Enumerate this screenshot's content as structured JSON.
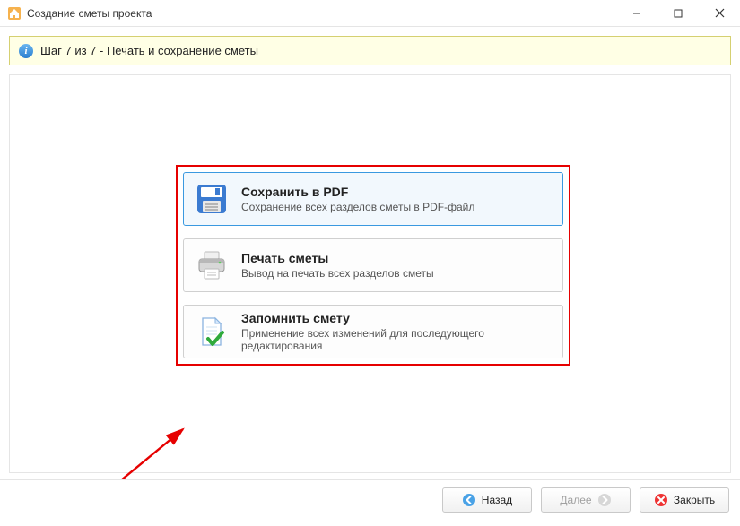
{
  "window": {
    "title": "Создание сметы проекта"
  },
  "infobar": {
    "text": "Шаг 7 из 7 - Печать и сохранение сметы"
  },
  "options": {
    "save_pdf": {
      "title": "Сохранить в PDF",
      "desc": "Сохранение всех разделов сметы в PDF-файл"
    },
    "print": {
      "title": "Печать сметы",
      "desc": "Вывод на печать всех разделов сметы"
    },
    "remember": {
      "title": "Запомнить смету",
      "desc": "Применение всех изменений для последующего редактирования"
    }
  },
  "footer": {
    "back": "Назад",
    "next": "Далее",
    "close": "Закрыть"
  }
}
